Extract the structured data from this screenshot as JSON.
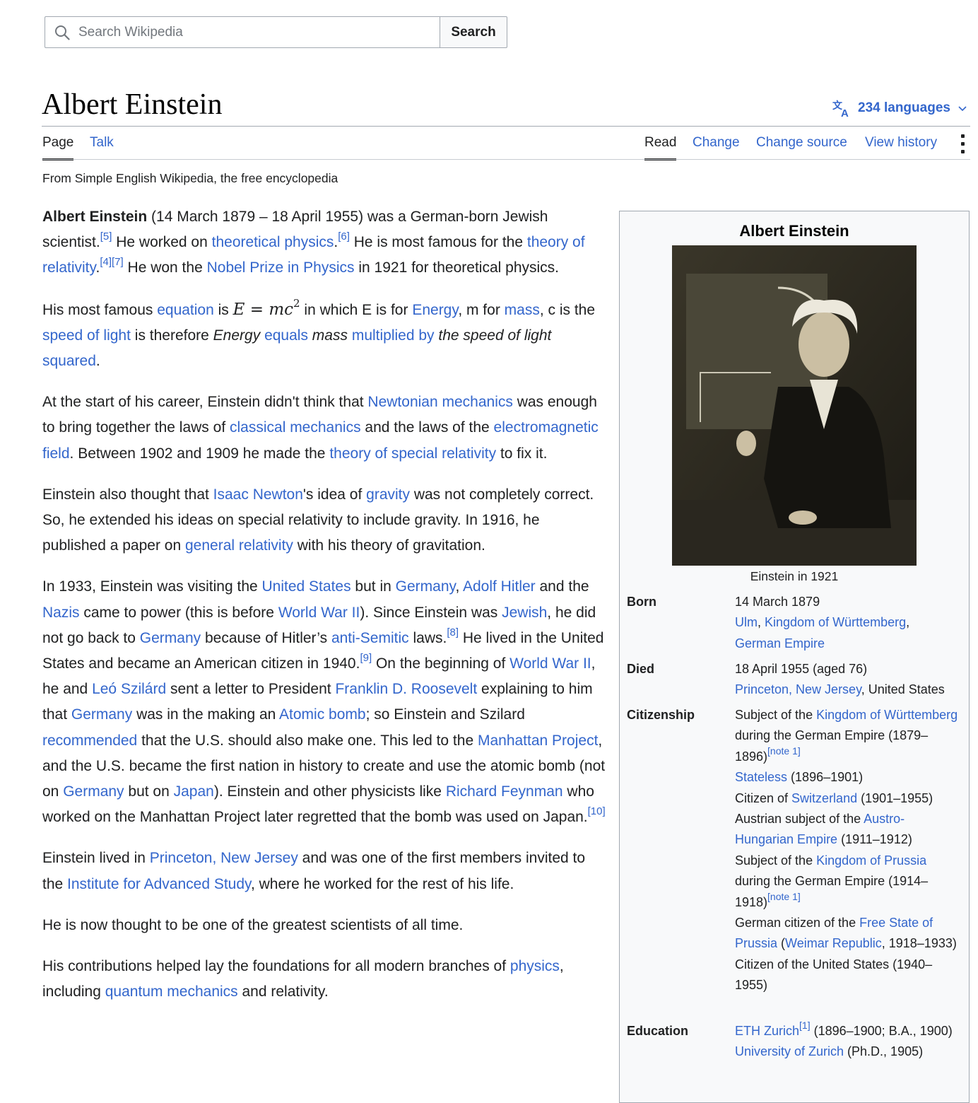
{
  "search": {
    "placeholder": "Search Wikipedia",
    "button": "Search"
  },
  "page": {
    "title": "Albert Einstein",
    "languages": "234 languages",
    "tagline": "From Simple English Wikipedia, the free encyclopedia"
  },
  "tabs": {
    "page": "Page",
    "talk": "Talk",
    "read": "Read",
    "change": "Change",
    "change_source": "Change source",
    "view_history": "View history"
  },
  "icons": [
    "search-icon",
    "translate-icon",
    "chevron-down-icon",
    "more-menu-icon"
  ],
  "colors": {
    "link": "#3366cc",
    "text": "#202122",
    "infobox_bg": "#f8f9fa",
    "border": "#a2a9b1"
  },
  "article": {
    "p1": {
      "name": "Albert Einstein",
      "t1": " (14 March 1879 – 18 April 1955) was a German-born Jewish scientist.",
      "r1": "[5]",
      "t2": " He worked on ",
      "l1": "theoretical physics",
      "t3": ".",
      "r2": "[6]",
      "t4": " He is most famous for the ",
      "l2": "theory of relativity",
      "t5": ".",
      "r3": "[4]",
      "r4": "[7]",
      "t6": " He won the ",
      "l3": "Nobel Prize in Physics",
      "t7": " in 1921 for theoretical physics."
    },
    "p2": {
      "t1": "His most famous ",
      "l1": "equation",
      "t2": " is ",
      "math_e": "E",
      "math_eq": " = ",
      "math_mc": "mc",
      "math_sq": "2",
      "t3": " in which E is for ",
      "l2": "Energy",
      "t4": ", m for ",
      "l3": "mass",
      "t5": ", c is the ",
      "l4": "speed of light",
      "t6": " is therefore ",
      "i1": "Energy",
      "t7": " ",
      "l5": "equals",
      "t8": " ",
      "i2": "mass",
      "t9": " ",
      "l6": "multiplied by",
      "t10": " ",
      "i3": "the speed of light",
      "t11": " ",
      "l7": "squared",
      "t12": "."
    },
    "p3": {
      "t1": "At the start of his career, Einstein didn't think that ",
      "l1": "Newtonian mechanics",
      "t2": " was enough to bring together the laws of ",
      "l2": "classical mechanics",
      "t3": " and the laws of the ",
      "l3": "electromagnetic field",
      "t4": ". Between 1902 and 1909 he made the ",
      "l4": "theory of special relativity",
      "t5": " to fix it."
    },
    "p4": {
      "t1": "Einstein also thought that ",
      "l1": "Isaac Newton",
      "t2": "'s idea of ",
      "l2": "gravity",
      "t3": " was not completely correct. So, he extended his ideas on special relativity to include gravity. In 1916, he published a paper on ",
      "l3": "general relativity",
      "t4": " with his theory of gravitation."
    },
    "p5": {
      "t1": "In 1933, Einstein was visiting the ",
      "l1": "United States",
      "t2": " but in ",
      "l2": "Germany",
      "t3": ", ",
      "l3": "Adolf Hitler",
      "t4": " and the ",
      "l4": "Nazis",
      "t5": " came to power (this is before ",
      "l5": "World War II",
      "t6": "). Since Einstein was ",
      "l6": "Jewish",
      "t7": ", he did not go back to ",
      "l7": "Germany",
      "t8": " because of Hitler’s ",
      "l8": "anti-Semitic",
      "t9": " laws.",
      "r1": "[8]",
      "t10": " He lived in the United States and became an American citizen in 1940.",
      "r2": "[9]",
      "t11": " On the beginning of ",
      "l9": "World War II",
      "t12": ", he and ",
      "l10": "Leó Szilárd",
      "t13": " sent a letter to President ",
      "l11": "Franklin D. Roosevelt",
      "t14": " explaining to him that ",
      "l12": "Germany",
      "t15": " was in the making an ",
      "l13": "Atomic bomb",
      "t16": "; so Einstein and Szilard ",
      "l14": "recommended",
      "t17": " that the U.S. should also make one. This led to the ",
      "l15": "Manhattan Project",
      "t18": ", and the U.S. became the first nation in history to create and use the atomic bomb (not on ",
      "l16": "Germany",
      "t19": " but on ",
      "l17": "Japan",
      "t20": "). Einstein and other physicists like ",
      "l18": "Richard Feynman",
      "t21": " who worked on the Manhattan Project later regretted that the bomb was used on Japan.",
      "r3": "[10]"
    },
    "p6": {
      "t1": "Einstein lived in ",
      "l1": "Princeton, New Jersey",
      "t2": " and was one of the first members invited to the ",
      "l2": "Institute for Advanced Study",
      "t3": ", where he worked for the rest of his life."
    },
    "p7": {
      "t1": "He is now thought to be one of the greatest scientists of all time."
    },
    "p8": {
      "t1": "His contributions helped lay the foundations for all modern branches of ",
      "l1": "physics",
      "t2": ", including ",
      "l2": "quantum mechanics",
      "t3": " and relativity."
    }
  },
  "infobox": {
    "title": "Albert Einstein",
    "caption": "Einstein in 1921",
    "born": {
      "label": "Born",
      "date": "14 March 1879",
      "l1": "Ulm",
      "t1": ", ",
      "l2": "Kingdom of Württemberg",
      "t2": ",",
      "l3": "German Empire"
    },
    "died": {
      "label": "Died",
      "date": "18 April 1955 (aged 76)",
      "l1": "Princeton, New Jersey",
      "t1": ", United States"
    },
    "citizenship": {
      "label": "Citizenship",
      "e1_t1": "Subject of the ",
      "e1_l1": "Kingdom of Württemberg",
      "e1_t2": " during the German Empire (1879–1896)",
      "e1_note": "[note 1]",
      "e2_l1": "Stateless",
      "e2_t1": " (1896–1901)",
      "e3_t1": "Citizen of ",
      "e3_l1": "Switzerland",
      "e3_t2": " (1901–1955)",
      "e4_t1": "Austrian subject of the ",
      "e4_l1": "Austro-Hungarian Empire",
      "e4_t2": " (1911–1912)",
      "e5_t1": "Subject of the ",
      "e5_l1": "Kingdom of Prussia",
      "e5_t2": " during the German Empire (1914–1918)",
      "e5_note": "[note 1]",
      "e6_t1": "German citizen of the ",
      "e6_l1": "Free State of Prussia",
      "e6_t2": " (",
      "e6_l2": "Weimar Republic",
      "e6_t3": ", 1918–1933)",
      "e7_t1": "Citizen of the United States (1940–1955)"
    },
    "education": {
      "label": "Education",
      "l1": "ETH Zurich",
      "r1": "[1]",
      "t1": " (1896–1900; B.A., 1900)",
      "l2": "University of Zurich",
      "t2": " (Ph.D., 1905)"
    }
  }
}
